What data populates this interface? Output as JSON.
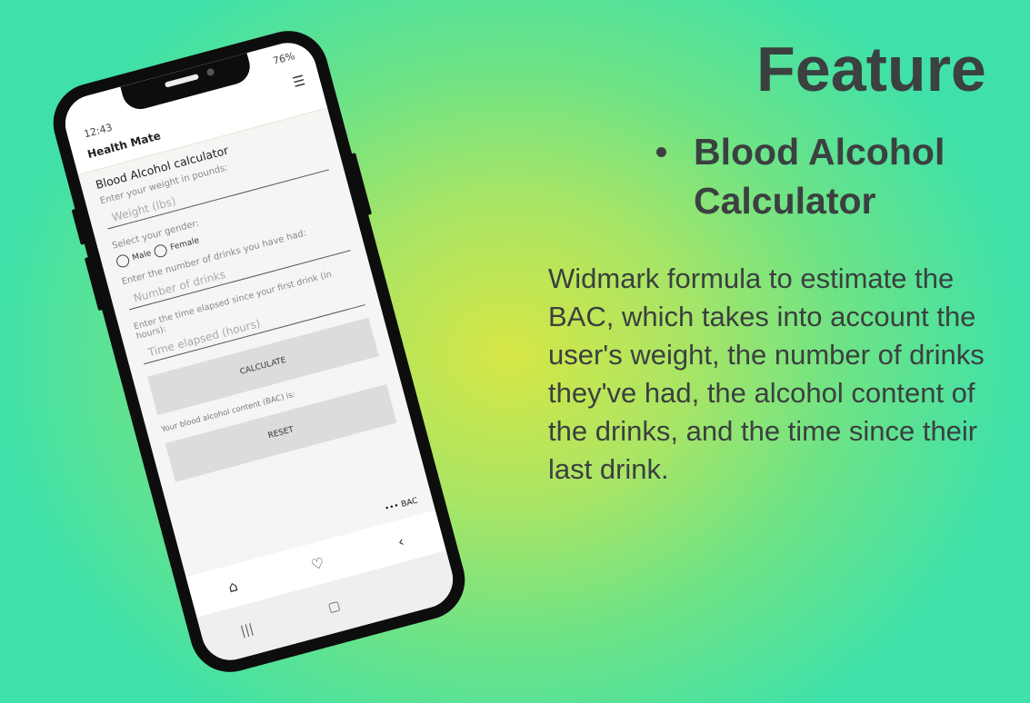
{
  "status": {
    "time": "12:43",
    "battery": "76%"
  },
  "app": {
    "title": "Health Mate",
    "filter_icon": "sliders-icon"
  },
  "form": {
    "heading": "Blood Alcohol calculator",
    "weight_label": "Enter your weight in pounds:",
    "weight_placeholder": "Weight (lbs)",
    "gender_label": "Select your gender:",
    "male": "Male",
    "female": "Female",
    "drinks_label": "Enter the number of drinks you have had:",
    "drinks_placeholder": "Number of drinks",
    "time_label": "Enter the time elapsed since your first drink (in hours):",
    "time_placeholder": "Time elapsed (hours)",
    "calculate": "CALCULATE",
    "result_label": "Your blood alcohol content (BAC) is:",
    "reset": "RESET"
  },
  "nav": {
    "more": "•••",
    "bac": "BAC"
  },
  "promo": {
    "title": "Feature",
    "bullet": "Blood Alcohol Calculator",
    "description": "Widmark formula to estimate the BAC, which takes into account the user's weight, the number of drinks they've had, the alcohol content of the drinks, and the time since their last drink."
  }
}
